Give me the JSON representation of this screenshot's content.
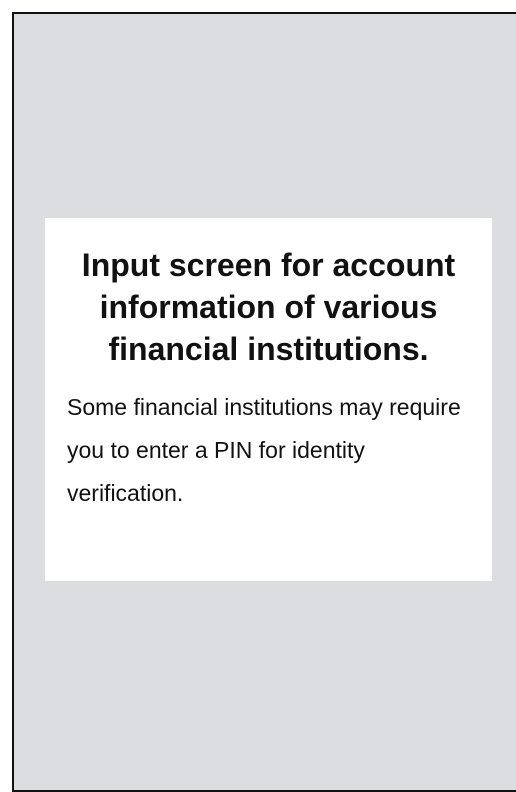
{
  "dialog": {
    "title": "Input screen for account information of various financial institutions.",
    "body": "Some financial institutions may require you to enter a PIN for identity verification."
  },
  "colors": {
    "backdrop": "#dcdde0",
    "card": "#ffffff",
    "frame_border": "#111111",
    "text": "#111111"
  }
}
